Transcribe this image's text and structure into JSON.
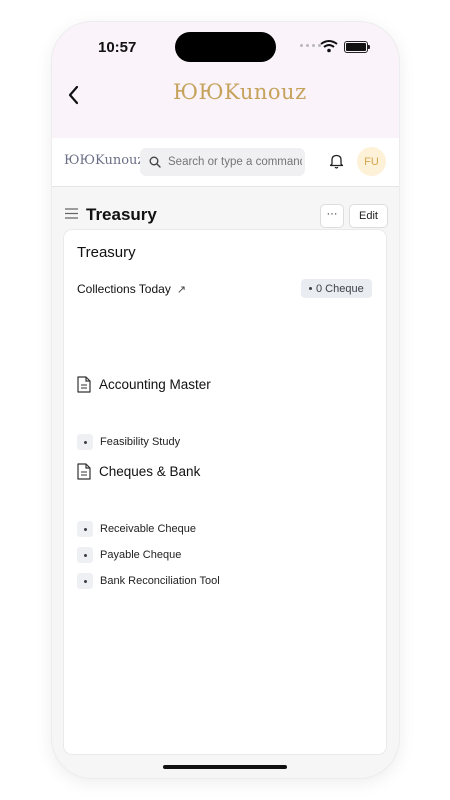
{
  "status_bar": {
    "time": "10:57"
  },
  "app_bar": {
    "back_icon": "chevron-left-icon",
    "brand": "ЮЮKunouz"
  },
  "toolbar": {
    "logo": "ЮЮKunouz",
    "search": {
      "placeholder": "Search or type a command",
      "icon": "search-icon"
    },
    "notifications_icon": "bell-icon",
    "avatar_initials": "FU",
    "avatar_color": "#fdf1d8"
  },
  "page": {
    "title": "Treasury",
    "more_label": "···",
    "edit_label": "Edit"
  },
  "card": {
    "title": "Treasury",
    "collections": {
      "label": "Collections Today",
      "arrow": "↗",
      "badge": "0 Cheque"
    },
    "sections": [
      {
        "title": "Accounting Master",
        "items": [
          "Feasibility Study"
        ]
      },
      {
        "title": "Cheques & Bank",
        "items": [
          "Receivable Cheque",
          "Payable Cheque",
          "Bank Reconciliation Tool"
        ]
      }
    ]
  }
}
